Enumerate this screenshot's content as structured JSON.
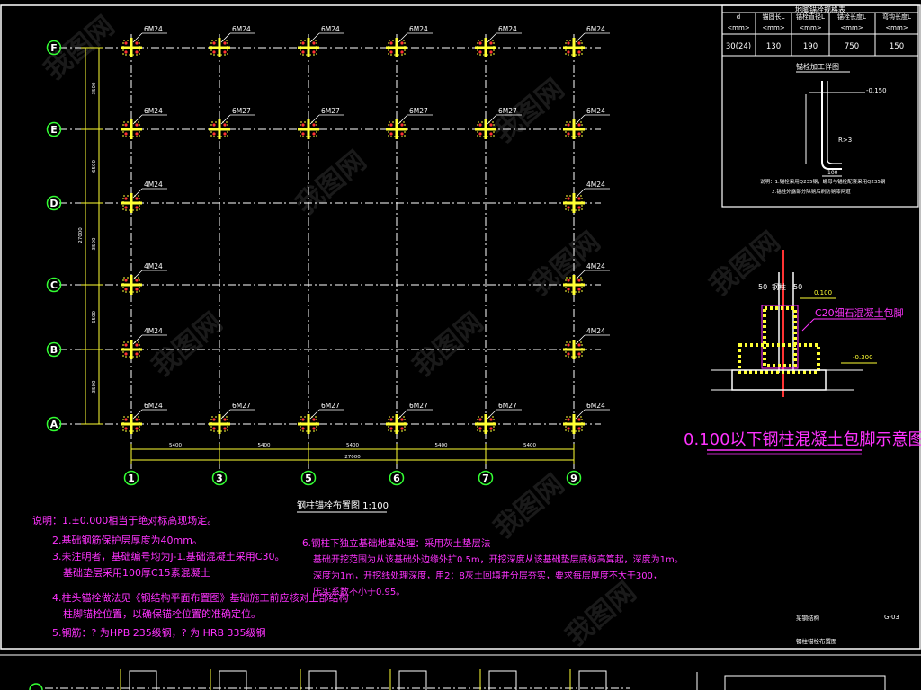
{
  "grid": {
    "rows": [
      "F",
      "E",
      "D",
      "C",
      "B",
      "A"
    ],
    "columns": [
      "1",
      "3",
      "5",
      "6",
      "7",
      "9"
    ],
    "bay_dims": [
      "5400",
      "5400",
      "5400",
      "5400",
      "5400"
    ],
    "total_width": "27000",
    "left_dims": [
      "3500",
      "6500",
      "3500",
      "6500",
      "3500"
    ],
    "total_height": "27000"
  },
  "bolt_labels": {
    "F": [
      "6M24",
      "6M24",
      "6M24",
      "6M24",
      "6M24",
      "6M24"
    ],
    "E": [
      "6M24",
      "6M27",
      "6M27",
      "6M27",
      "6M27",
      "6M24"
    ],
    "D": [
      "4M24",
      "",
      "",
      "",
      "",
      "4M24"
    ],
    "C": [
      "4M24",
      "",
      "",
      "",
      "",
      "4M24"
    ],
    "B": [
      "4M24",
      "",
      "",
      "",
      "",
      "4M24"
    ],
    "A": [
      "6M24",
      "6M27",
      "6M27",
      "6M27",
      "6M27",
      "6M24"
    ]
  },
  "plan_title": "钢柱锚栓布置图 1:100",
  "notes_left": [
    "说明：1.±0.000相当于绝对标高现场定。",
    "2.基础钢筋保护层厚度为40mm。",
    "3.未注明者，基础编号均为J-1.基础混凝土采用C30。",
    "基础垫层采用100厚C15素混凝土",
    "4.柱头锚栓做法见《钢结构平面布置图》基础施工前应核对上部结构",
    "柱脚锚栓位置，以确保锚栓位置的准确定位。",
    "5.钢筋：? 为HPB 235级钢，? 为 HRB 335级钢"
  ],
  "notes_right": [
    "6.钢柱下独立基础地基处理：采用灰土垫层法",
    "基础开挖范围为从该基础外边缘外扩0.5m，开挖深度从该基础垫层底标高算起，深度为1m。",
    "深度为1m，开挖线处理深度，用2：8灰土回填并分层夯实，要求每层厚度不大于300，",
    "压实系数不小于0.95。"
  ],
  "table": {
    "title": "地脚锚栓规格表",
    "headers": [
      "d",
      "锚固长L",
      "锚栓直径L",
      "锚栓长度L",
      "弯钩长度L"
    ],
    "units": [
      "<mm>",
      "<mm>",
      "<mm>",
      "<mm>",
      "<mm>"
    ],
    "row": [
      "30(24)",
      "130",
      "190",
      "750",
      "150"
    ]
  },
  "anchor_detail": {
    "title": "锚栓加工详图",
    "elev": "-0.150",
    "r_label": "R>3",
    "dim": "100",
    "notes": [
      "说明：1.锚栓采用Q235钢，螺母与锚栓配套采用Q235钢",
      "2.锚栓外露部分除锈后刷防锈漆两道"
    ]
  },
  "encase_detail": {
    "label_c20": "C20细石混凝土包脚",
    "label_col": "钢柱",
    "dim_left": "50",
    "dim_right": "50",
    "elev_top": "0.100",
    "elev_bottom": "-0.300",
    "caption": "0.100以下钢柱混凝土包脚示意图"
  },
  "title_block": {
    "name": "某钢结构",
    "sheet": "G-03",
    "drawing": "钢柱锚栓布置图"
  },
  "watermark": "我图网"
}
